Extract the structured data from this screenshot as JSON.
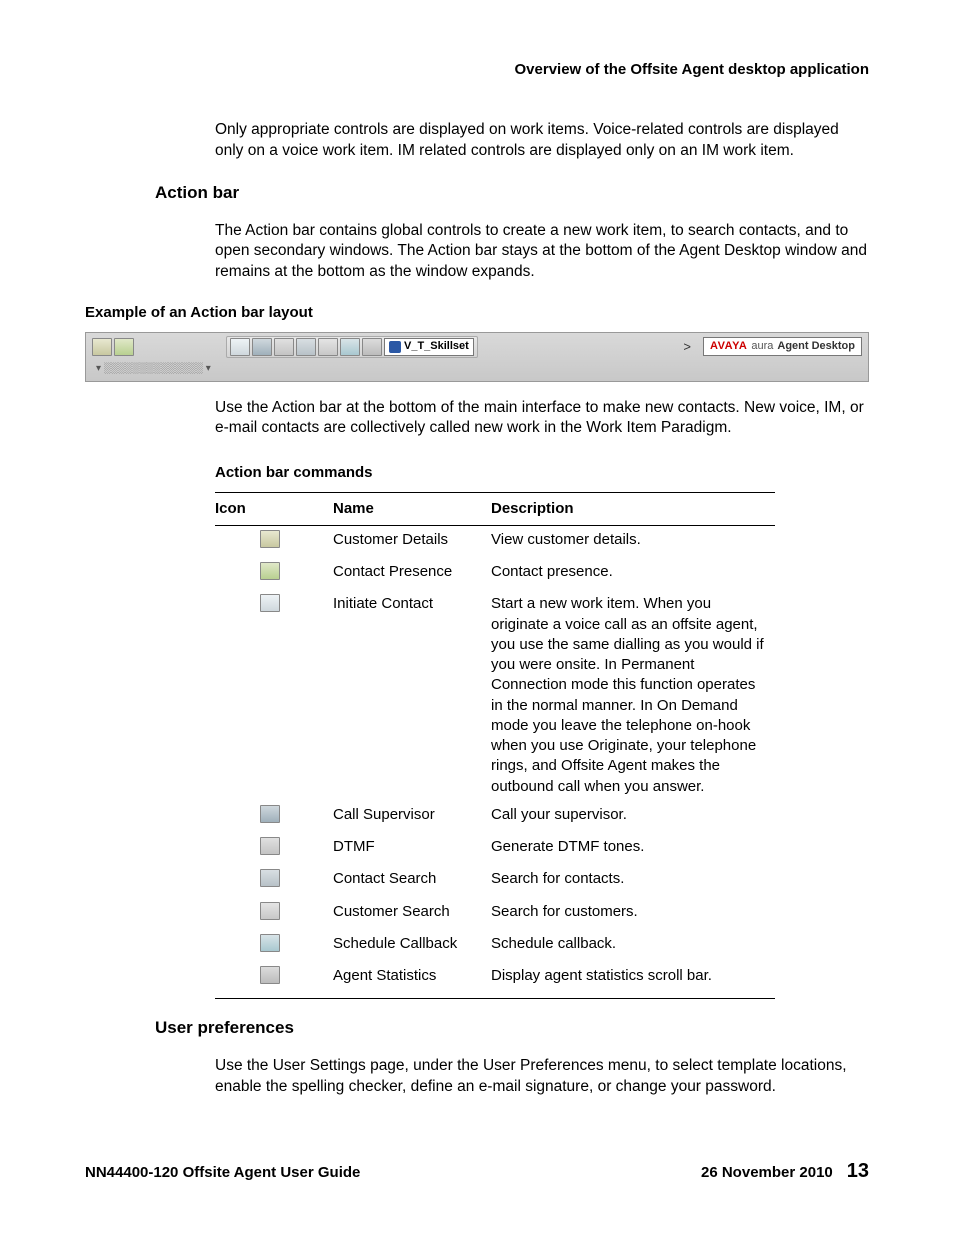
{
  "running_head": "Overview of the Offsite Agent desktop application",
  "intro_para": "Only appropriate controls are displayed on work items. Voice-related controls are displayed only on a voice work item. IM related controls are displayed only on an IM work item.",
  "actionbar": {
    "heading": "Action bar",
    "para": "The Action bar contains global controls to create a new work item, to search contacts, and to open secondary windows. The Action bar stays at the bottom of the Agent Desktop window and remains at the bottom as the window expands.",
    "example_caption": "Example of an Action bar layout",
    "skillset_label": "V_T_Skillset",
    "brand_avaya": "AVAYA",
    "brand_aura": "aura",
    "brand_rest": "Agent Desktop",
    "row2_placeholder": "▾ ░░░░░░░░░░░░░░ ▾",
    "usage_para": "Use the Action bar at the bottom of the main interface to make new contacts. New voice, IM, or e-mail contacts are collectively called new work in the Work Item Paradigm."
  },
  "commands_caption": "Action bar commands",
  "commands_headers": {
    "icon": "Icon",
    "name": "Name",
    "desc": "Description"
  },
  "commands": [
    {
      "icon": "ic-cd",
      "name": "Customer Details",
      "desc": "View customer details."
    },
    {
      "icon": "ic-cp",
      "name": "Contact Presence",
      "desc": "Contact presence."
    },
    {
      "icon": "ic-init",
      "name": "Initiate Contact",
      "desc": "Start a new work item. When you originate a voice call as an offsite agent, you use the same dialling as you would if you were onsite. In Permanent Connection mode this function operates in the normal manner. In On Demand mode you leave the telephone on-hook when you use Originate, your telephone rings, and Offsite Agent makes the outbound call when you answer."
    },
    {
      "icon": "ic-sup",
      "name": "Call Supervisor",
      "desc": "Call your supervisor."
    },
    {
      "icon": "ic-dtmf",
      "name": "DTMF",
      "desc": "Generate DTMF tones."
    },
    {
      "icon": "ic-srch",
      "name": "Contact Search",
      "desc": "Search for contacts."
    },
    {
      "icon": "ic-cust",
      "name": "Customer Search",
      "desc": "Search for customers."
    },
    {
      "icon": "ic-cb",
      "name": "Schedule Callback",
      "desc": "Schedule callback."
    },
    {
      "icon": "ic-stat",
      "name": "Agent Statistics",
      "desc": "Display agent statistics scroll bar."
    }
  ],
  "userprefs": {
    "heading": "User preferences",
    "para": "Use the User Settings page, under the User Preferences menu, to select template locations, enable the spelling checker, define an e-mail signature, or change your password."
  },
  "footer": {
    "doc": "NN44400-120 Offsite Agent User Guide",
    "date": "26 November 2010",
    "page": "13"
  }
}
